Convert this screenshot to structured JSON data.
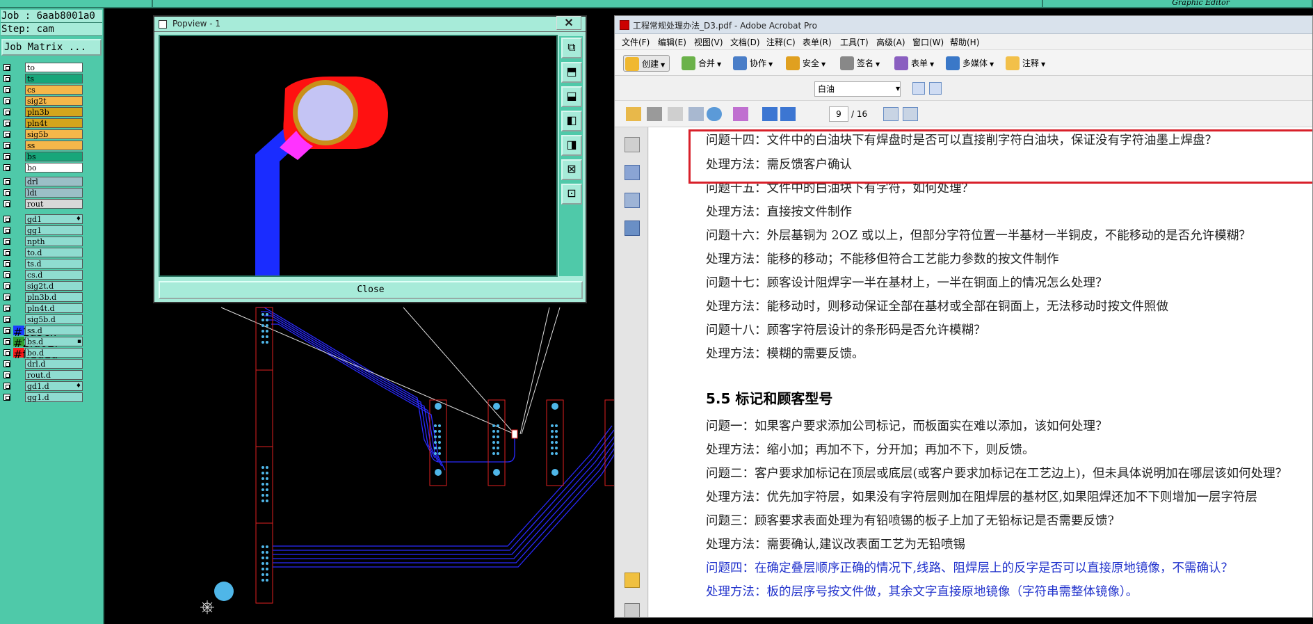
{
  "left_panel": {
    "job_label": "Job : 6aab8001a0",
    "step_label": "Step: cam",
    "job_matrix_label": "Job Matrix ...",
    "layers": [
      {
        "name": "to",
        "color": "#ffffff",
        "swatch": "",
        "mark": ""
      },
      {
        "name": "ts",
        "color": "#17a67a",
        "swatch": "",
        "mark": ""
      },
      {
        "name": "cs",
        "color": "#f5b74a",
        "swatch": "",
        "mark": ""
      },
      {
        "name": "sig2t",
        "color": "#f5b74a",
        "swatch": "",
        "mark": ""
      },
      {
        "name": "pln3b",
        "color": "#d4a51c",
        "swatch": "",
        "mark": ""
      },
      {
        "name": "pln4t",
        "color": "#d4a51c",
        "swatch": "",
        "mark": ""
      },
      {
        "name": "sig5b",
        "color": "#f5b74a",
        "swatch": "",
        "mark": ""
      },
      {
        "name": "ss",
        "color": "#f5b74a",
        "swatch": "",
        "mark": ""
      },
      {
        "name": "bs",
        "color": "#17a67a",
        "swatch": "",
        "mark": ""
      },
      {
        "name": "bo",
        "color": "#ffffff",
        "swatch": "",
        "mark": ""
      },
      {
        "name": "drl",
        "color": "#9bbfc7",
        "swatch": "",
        "mark": ""
      },
      {
        "name": "ldi",
        "color": "#9bbfc7",
        "swatch": "",
        "mark": ""
      },
      {
        "name": "rout",
        "color": "#d8d8d8",
        "swatch": "",
        "mark": ""
      },
      {
        "name": "gd1",
        "color": "#8fdcd0",
        "swatch": "",
        "mark": "♦"
      },
      {
        "name": "gg1",
        "color": "#8fdcd0",
        "swatch": "",
        "mark": ""
      },
      {
        "name": "npth",
        "color": "#8fdcd0",
        "swatch": "",
        "mark": ""
      },
      {
        "name": "to.d",
        "color": "#8fdcd0",
        "swatch": "",
        "mark": ""
      },
      {
        "name": "ts.d",
        "color": "#8fdcd0",
        "swatch": "",
        "mark": ""
      },
      {
        "name": "cs.d",
        "color": "#8fdcd0",
        "swatch": "",
        "mark": ""
      },
      {
        "name": "sig2t.d",
        "color": "#8fdcd0",
        "swatch": "",
        "mark": ""
      },
      {
        "name": "pln3b.d",
        "color": "#8fdcd0",
        "swatch": "",
        "mark": ""
      },
      {
        "name": "pln4t.d",
        "color": "#8fdcd0",
        "swatch": "",
        "mark": ""
      },
      {
        "name": "sig5b.d",
        "color": "#8fdcd0",
        "swatch": "",
        "mark": ""
      },
      {
        "name": "ss.d",
        "color": "#8fdcd0",
        "swatch": "#1a3cff",
        "mark": ""
      },
      {
        "name": "bs.d",
        "color": "#8fdcd0",
        "swatch": "#2fa02f",
        "mark": "▪"
      },
      {
        "name": "bo.d",
        "color": "#8fdcd0",
        "swatch": "#ff1a1a",
        "mark": ""
      },
      {
        "name": "drl.d",
        "color": "#8fdcd0",
        "swatch": "",
        "mark": ""
      },
      {
        "name": "rout.d",
        "color": "#8fdcd0",
        "swatch": "",
        "mark": ""
      },
      {
        "name": "gd1.d",
        "color": "#8fdcd0",
        "swatch": "",
        "mark": "♦"
      },
      {
        "name": "gg1.d",
        "color": "#8fdcd0",
        "swatch": "",
        "mark": ""
      }
    ]
  },
  "graphic_editor_title": "Graphic Editor",
  "popview": {
    "title": "Popview - 1",
    "close_x": "✕",
    "close_button": "Close"
  },
  "acrobat": {
    "title": "工程常规处理办法_D3.pdf - Adobe Acrobat Pro",
    "menu": [
      "文件(F)",
      "编辑(E)",
      "视图(V)",
      "文档(D)",
      "注释(C)",
      "表单(R)",
      "工具(T)",
      "高级(A)",
      "窗口(W)",
      "帮助(H)"
    ],
    "toolbar": [
      "创建",
      "合并",
      "协作",
      "安全",
      "签名",
      "表单",
      "多媒体",
      "注释"
    ],
    "font_value": "白油",
    "page_current": "9",
    "page_total": "/ 16",
    "lines": [
      {
        "text": "问题十四：文件中的白油块下有焊盘时是否可以直接削字符白油块，保证没有字符油墨上焊盘？",
        "style": "normal"
      },
      {
        "text": "处理方法：需反馈客户确认",
        "style": "normal"
      },
      {
        "text": "问题十五：文件中的白油块下有字符，如何处理？",
        "style": "normal"
      },
      {
        "text": "处理方法：直接按文件制作",
        "style": "normal"
      },
      {
        "text": "问题十六：外层基铜为 2OZ 或以上，但部分字符位置一半基材一半铜皮，不能移动的是否允许模糊？",
        "style": "normal"
      },
      {
        "text": "处理方法：能移的移动；不能移但符合工艺能力参数的按文件制作",
        "style": "normal"
      },
      {
        "text": "问题十七：顾客设计阻焊字一半在基材上，一半在铜面上的情况怎么处理？",
        "style": "normal"
      },
      {
        "text": "处理方法：能移动时，则移动保证全部在基材或全部在铜面上，无法移动时按文件照做",
        "style": "normal"
      },
      {
        "text": "问题十八：顾客字符层设计的条形码是否允许模糊？",
        "style": "normal"
      },
      {
        "text": "处理方法：模糊的需要反馈。",
        "style": "normal"
      },
      {
        "text": "5.5 标记和顾客型号",
        "style": "head"
      },
      {
        "text": "问题一：如果客户要求添加公司标记，而板面实在难以添加，该如何处理？",
        "style": "normal"
      },
      {
        "text": "处理方法：缩小加；再加不下，分开加；再加不下，则反馈。",
        "style": "normal"
      },
      {
        "text": "问题二：客户要求加标记在顶层或底层(或客户要求加标记在工艺边上)，但未具体说明加在哪层该如何处理？",
        "style": "normal"
      },
      {
        "text": "处理方法：优先加字符层，如果没有字符层则加在阻焊层的基材区,如果阻焊还加不下则增加一层字符层",
        "style": "normal"
      },
      {
        "text": "问题三：顾客要求表面处理为有铅喷锡的板子上加了无铅标记是否需要反馈?",
        "style": "normal"
      },
      {
        "text": "处理方法：需要确认,建议改表面工艺为无铅喷锡",
        "style": "normal"
      },
      {
        "text": "问题四：在确定叠层顺序正确的情况下,线路、阻焊层上的反字是否可以直接原地镜像，不需确认？",
        "style": "blue"
      },
      {
        "text": "处理方法：板的层序号按文件做，其余文字直接原地镜像（字符串需整体镜像）。",
        "style": "blue"
      }
    ]
  }
}
